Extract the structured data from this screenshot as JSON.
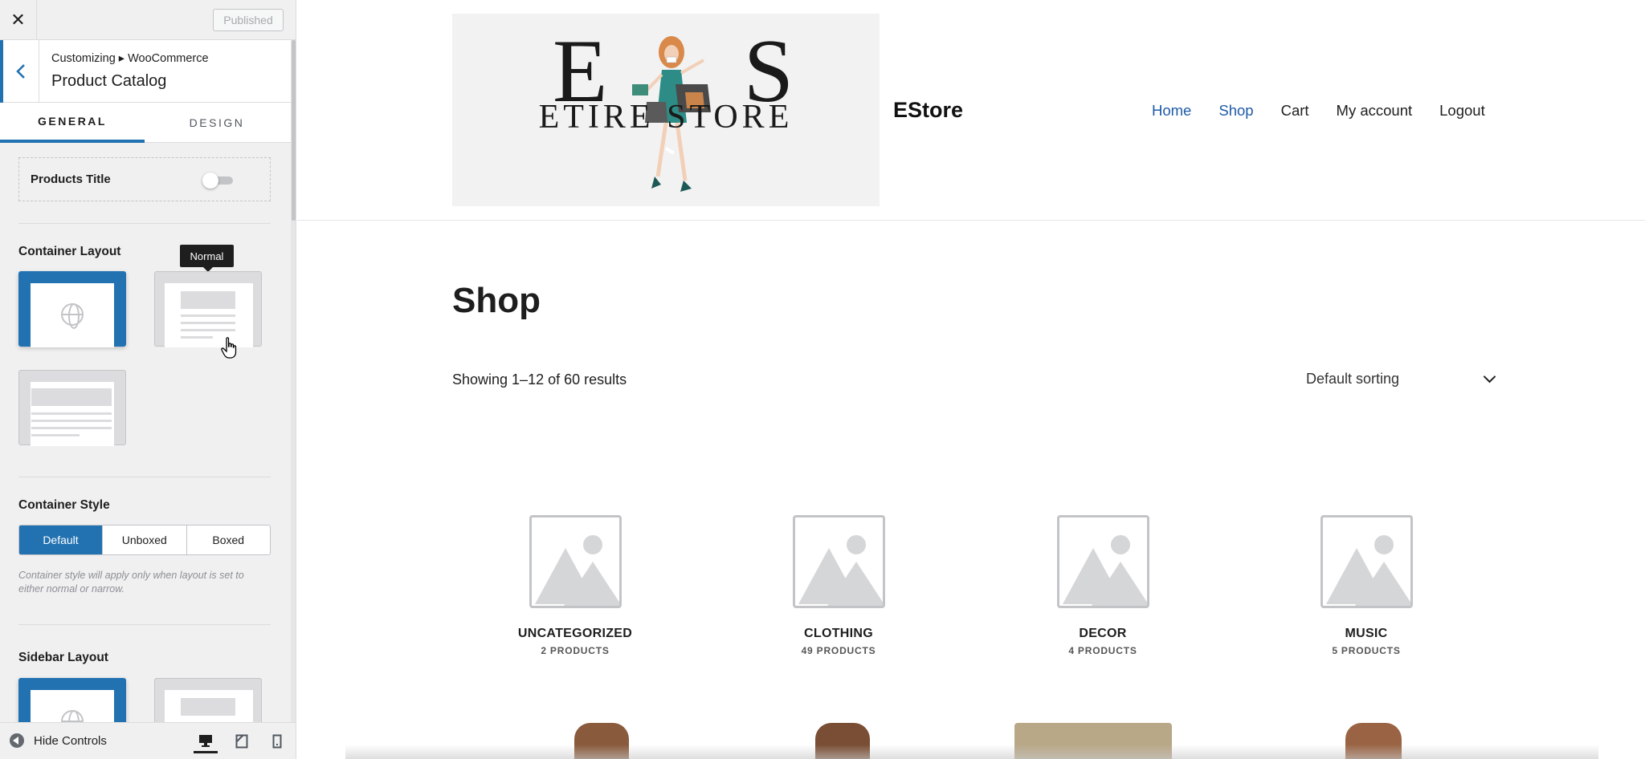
{
  "customizer": {
    "close_icon": "close-icon",
    "publish_label": "Published",
    "breadcrumb": "Customizing ▸ WooCommerce",
    "section_title": "Product Catalog",
    "tabs": [
      {
        "label": "GENERAL",
        "active": true
      },
      {
        "label": "DESIGN",
        "active": false
      }
    ],
    "products_title": {
      "label": "Products Title",
      "enabled": false
    },
    "container_layout": {
      "label": "Container Layout",
      "tooltip": "Normal",
      "selected": "full-width"
    },
    "container_style": {
      "label": "Container Style",
      "options": [
        "Default",
        "Unboxed",
        "Boxed"
      ],
      "selected": "Default",
      "note": "Container style will apply only when layout is set to either normal or narrow."
    },
    "sidebar_layout": {
      "label": "Sidebar Layout"
    },
    "footer": {
      "hide_controls_label": "Hide Controls",
      "active_device": "desktop"
    },
    "accent_color": "#2271b1"
  },
  "site": {
    "logo_letters": [
      "E",
      "S"
    ],
    "logo_text": "ETIRE STORE",
    "title": "EStore",
    "nav": [
      {
        "label": "Home",
        "current": true
      },
      {
        "label": "Shop",
        "current": true
      },
      {
        "label": "Cart",
        "current": false
      },
      {
        "label": "My account",
        "current": false
      },
      {
        "label": "Logout",
        "current": false
      }
    ],
    "page_title": "Shop",
    "result_count": "Showing 1–12 of 60 results",
    "sorting": "Default sorting",
    "categories": [
      {
        "name": "UNCATEGORIZED",
        "count": "2 PRODUCTS"
      },
      {
        "name": "CLOTHING",
        "count": "49 PRODUCTS"
      },
      {
        "name": "DECOR",
        "count": "4 PRODUCTS"
      },
      {
        "name": "MUSIC",
        "count": "5 PRODUCTS"
      }
    ]
  }
}
